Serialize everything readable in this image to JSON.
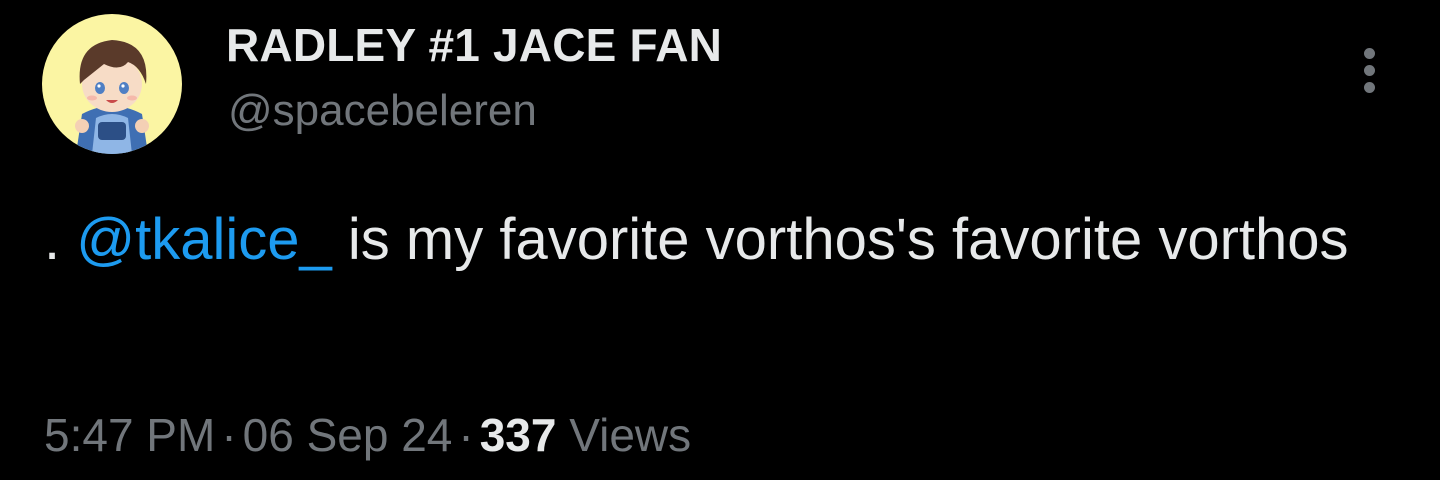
{
  "author": {
    "display_name": "RADLEY #1 JACE FAN",
    "handle": "@spacebeleren",
    "avatar_icon": "chibi-character-avatar"
  },
  "more_menu_icon": "more-vertical-icon",
  "tweet": {
    "prefix": ". ",
    "mention": "@tkalice_",
    "body": " is my favorite vorthos's favorite vorthos"
  },
  "meta": {
    "time": "5:47 PM",
    "separator": "·",
    "date": "06 Sep 24",
    "view_count": "337",
    "views_label": "Views"
  },
  "colors": {
    "background": "#000000",
    "text": "#e7e9ea",
    "secondary": "#71767b",
    "link": "#1d9bf0",
    "avatar_bg": "#fbf5a3"
  }
}
